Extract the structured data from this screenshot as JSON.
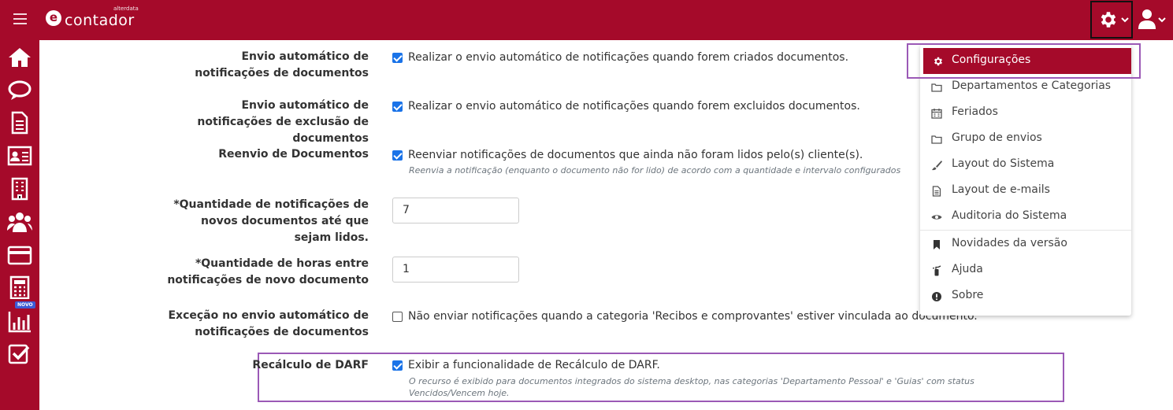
{
  "header": {
    "brand": "contador",
    "brand_tag": "alterdata",
    "logo_letter": "e",
    "menu_icon": "hamburger-icon",
    "settings_icon": "gear-icon",
    "user_icon": "user-icon"
  },
  "sidebar": {
    "items": [
      {
        "icon": "home-icon"
      },
      {
        "icon": "chat-icon"
      },
      {
        "icon": "document-icon"
      },
      {
        "icon": "id-card-icon"
      },
      {
        "icon": "building-icon"
      },
      {
        "icon": "users-icon"
      },
      {
        "icon": "credit-card-icon"
      },
      {
        "icon": "calculator-icon"
      },
      {
        "icon": "bar-chart-icon",
        "badge": "NOVO"
      },
      {
        "icon": "checkbox-icon"
      }
    ]
  },
  "settings": {
    "rows": [
      {
        "label": "Envio automático de notificações de documentos",
        "checked": true,
        "option": "Realizar o envio automático de notificações quando forem criados documentos."
      },
      {
        "label": "Envio automático de notificações de exclusão de documentos",
        "checked": true,
        "option": "Realizar o envio automático de notificações quando forem excluidos documentos."
      },
      {
        "label": "Reenvio de Documentos",
        "checked": true,
        "option": "Reenviar notificações de documentos que ainda não foram lidos pelo(s) cliente(s).",
        "hint": "Reenvia a notificação (enquanto o documento não for lido) de acordo com a quantidade e intervalo configurados"
      },
      {
        "label": "*Quantidade de notificações de novos documentos até que sejam lidos.",
        "value": "7"
      },
      {
        "label": "*Quantidade de horas entre notificações de novo documento",
        "value": "1"
      },
      {
        "label": "Exceção no envio automático de notificações de documentos",
        "checked": false,
        "option": "Não enviar notificações quando a categoria 'Recibos e comprovantes' estiver vinculada ao documento."
      },
      {
        "label": "Recálculo de DARF",
        "checked": true,
        "option": "Exibir a funcionalidade de Recálculo de DARF.",
        "hint": "O recurso é exibido para documentos integrados do sistema desktop, nas categorias 'Departamento Pessoal' e 'Guias' com status Vencidos/Vencem hoje."
      }
    ]
  },
  "dropdown": {
    "items": [
      {
        "label": "Configurações",
        "icon": "gear-icon"
      },
      {
        "label": "Departamentos e Categorias",
        "icon": "folder-icon"
      },
      {
        "label": "Feriados",
        "icon": "calendar-icon"
      },
      {
        "label": "Grupo de envios",
        "icon": "folder-icon"
      },
      {
        "label": "Layout do Sistema",
        "icon": "brush-icon"
      },
      {
        "label": "Layout de e-mails",
        "icon": "file-text-icon"
      },
      {
        "label": "Auditoria do Sistema",
        "icon": "eye-icon"
      },
      {
        "label": "Novidades da versão",
        "icon": "bookmark-icon"
      },
      {
        "label": "Ajuda",
        "icon": "extinguisher-icon"
      },
      {
        "label": "Sobre",
        "icon": "info-icon"
      }
    ]
  },
  "colors": {
    "brand": "#a50a2a",
    "checkbox": "#1a73e8",
    "highlight": "#9b59b6"
  }
}
